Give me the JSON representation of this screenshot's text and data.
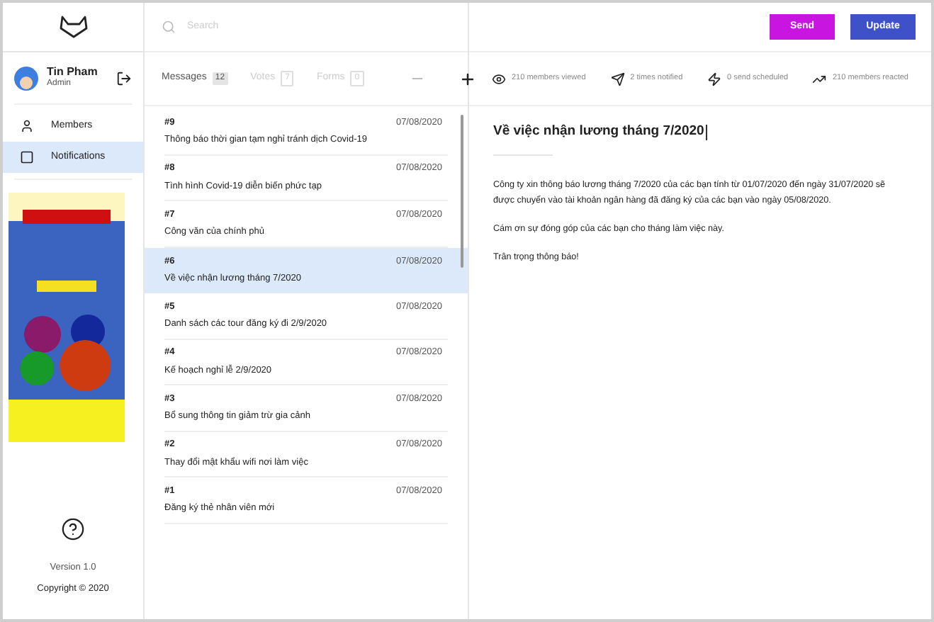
{
  "search": {
    "placeholder": "Search"
  },
  "buttons": [
    {
      "label": "Send",
      "kind": "send"
    },
    {
      "label": "Update",
      "kind": "update"
    }
  ],
  "user": {
    "name": "Tin Pham",
    "role": "Admin"
  },
  "nav": [
    {
      "label": "Members",
      "kind": "members",
      "selected": false
    },
    {
      "label": "Notifications",
      "kind": "notifications",
      "selected": true
    }
  ],
  "footer": {
    "version": "Version 1.0",
    "copyright": "Copyright © 2020"
  },
  "tabs": [
    {
      "label": "Messages",
      "count": "12",
      "selected": true
    },
    {
      "label": "Votes",
      "count": "7",
      "selected": false
    },
    {
      "label": "Forms",
      "count": "0",
      "selected": false
    }
  ],
  "messages": [
    {
      "number": "#9",
      "date": "07/08/2020",
      "title": "Thông báo thời gian tạm nghỉ tránh dịch Covid-19",
      "selected": false
    },
    {
      "number": "#8",
      "date": "07/08/2020",
      "title": "Tình hình Covid-19 diễn biến phức tạp",
      "selected": false
    },
    {
      "number": "#7",
      "date": "07/08/2020",
      "title": "Công văn của chính phủ",
      "selected": false
    },
    {
      "number": "#6",
      "date": "07/08/2020",
      "title": "Về việc nhận lương tháng 7/2020",
      "selected": true
    },
    {
      "number": "#5",
      "date": "07/08/2020",
      "title": "Danh sách các tour đăng ký đi 2/9/2020",
      "selected": false
    },
    {
      "number": "#4",
      "date": "07/08/2020",
      "title": "Kế hoạch nghỉ lễ 2/9/2020",
      "selected": false
    },
    {
      "number": "#3",
      "date": "07/08/2020",
      "title": "Bổ sung thông tin giảm trừ gia cảnh",
      "selected": false
    },
    {
      "number": "#2",
      "date": "07/08/2020",
      "title": "Thay đổi mật khẩu wifi nơi làm việc",
      "selected": false
    },
    {
      "number": "#1",
      "date": "07/08/2020",
      "title": "Đăng ký thẻ nhân viên mới",
      "selected": false
    }
  ],
  "stats": [
    {
      "kind": "viewed",
      "text": "210 members viewed"
    },
    {
      "kind": "notified",
      "text": "2 times notified"
    },
    {
      "kind": "scheduled",
      "text": "0 send scheduled"
    },
    {
      "kind": "reacted",
      "text": "210 members reacted"
    }
  ],
  "detail": {
    "title": "Về việc nhận lương tháng 7/2020",
    "paragraphs": [
      "Công ty xin thông báo lương tháng 7/2020 của các bạn tính từ 01/07/2020 đến ngày 31/07/2020 sẽ được chuyển vào tài khoản ngân hàng đã đăng ký của các bạn vào ngày 05/08/2020.",
      "Cám ơn sự đóng góp của các bạn cho tháng làm việc này.",
      "Trân trọng thông báo!"
    ]
  }
}
